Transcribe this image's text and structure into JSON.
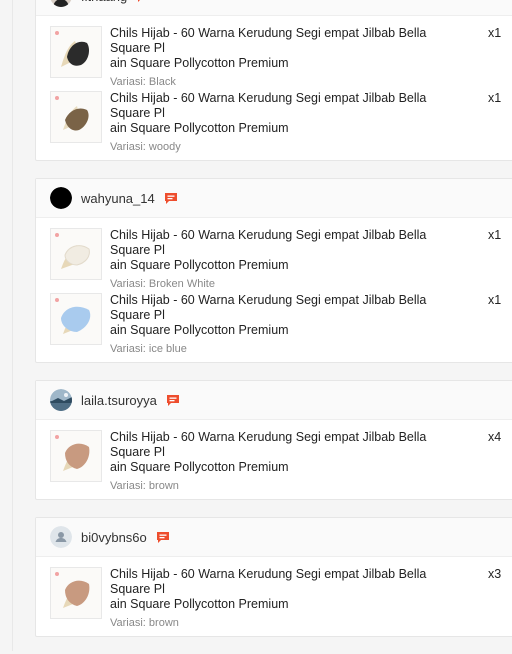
{
  "orders": [
    {
      "username": "fitriaang",
      "avatar": "user-avatar-dark",
      "items": [
        {
          "title": "Chils Hijab - 60 Warna Kerudung Segi empat Jilbab Bella Square Plain Square Pollycotton Premium",
          "title_line1": "Chils Hijab - 60 Warna Kerudung Segi empat Jilbab Bella Square Pl",
          "title_line2": "ain Square Pollycotton Premium",
          "variant": "Variasi: Black",
          "qty": "x1",
          "color": "#2b2b2b"
        },
        {
          "title": "Chils Hijab - 60 Warna Kerudung Segi empat Jilbab Bella Square Plain Square Pollycotton Premium",
          "title_line1": "Chils Hijab - 60 Warna Kerudung Segi empat Jilbab Bella Square Pl",
          "title_line2": "ain Square Pollycotton Premium",
          "variant": "Variasi: woody",
          "qty": "x1",
          "color": "#7a6347"
        }
      ]
    },
    {
      "username": "wahyuna_14",
      "avatar": "user-avatar-black",
      "items": [
        {
          "title": "Chils Hijab - 60 Warna Kerudung Segi empat Jilbab Bella Square Plain Square Pollycotton Premium",
          "title_line1": "Chils Hijab - 60 Warna Kerudung Segi empat Jilbab Bella Square Pl",
          "title_line2": "ain Square Pollycotton Premium",
          "variant": "Variasi: Broken White",
          "qty": "x1",
          "color": "#f1ece2"
        },
        {
          "title": "Chils Hijab - 60 Warna Kerudung Segi empat Jilbab Bella Square Plain Square Pollycotton Premium",
          "title_line1": "Chils Hijab - 60 Warna Kerudung Segi empat Jilbab Bella Square Pl",
          "title_line2": "ain Square Pollycotton Premium",
          "variant": "Variasi: ice blue",
          "qty": "x1",
          "color": "#a9cbee"
        }
      ]
    },
    {
      "username": "laila.tsuroyya",
      "avatar": "user-avatar-photo",
      "items": [
        {
          "title": "Chils Hijab - 60 Warna Kerudung Segi empat Jilbab Bella Square Plain Square Pollycotton Premium",
          "title_line1": "Chils Hijab - 60 Warna Kerudung Segi empat Jilbab Bella Square Pl",
          "title_line2": "ain Square Pollycotton Premium",
          "variant": "Variasi: brown",
          "qty": "x4",
          "color": "#c89a80"
        }
      ]
    },
    {
      "username": "bi0vybns6o",
      "avatar": "default-user-avatar",
      "items": [
        {
          "title": "Chils Hijab - 60 Warna Kerudung Segi empat Jilbab Bella Square Plain Square Pollycotton Premium",
          "title_line1": "Chils Hijab - 60 Warna Kerudung Segi empat Jilbab Bella Square Pl",
          "title_line2": "ain Square Pollycotton Premium",
          "variant": "Variasi: brown",
          "qty": "x3",
          "color": "#c89a80"
        }
      ]
    }
  ],
  "colors": {
    "chat_icon": "#ee4d2d",
    "border": "#e6e6e6"
  },
  "icons": {
    "chat": "chat-icon"
  }
}
